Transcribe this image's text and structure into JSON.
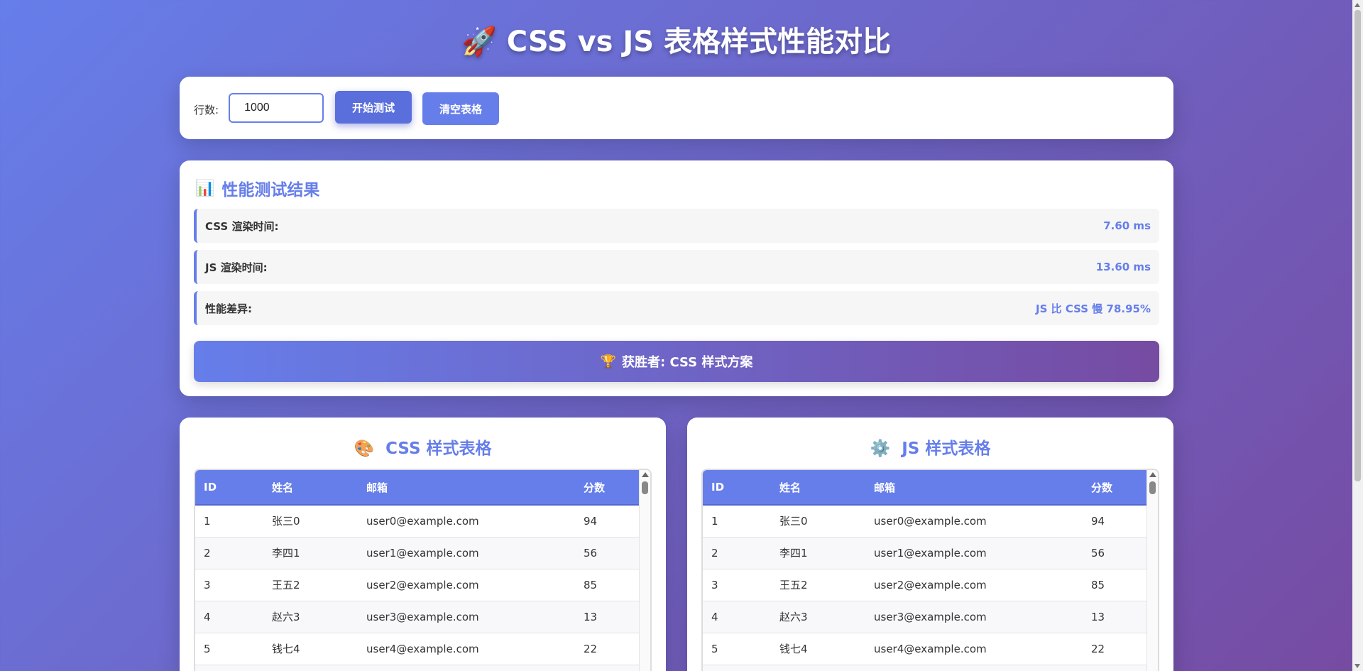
{
  "header": {
    "icon": "rocket-icon",
    "icon_glyph": "🚀",
    "title": "CSS vs JS 表格样式性能对比"
  },
  "controls": {
    "rows_label": "行数:",
    "rows_value": "1000",
    "start_label": "开始测试",
    "clear_label": "清空表格"
  },
  "results": {
    "icon": "bar-chart-icon",
    "icon_glyph": "📊",
    "title": "性能测试结果",
    "metrics": [
      {
        "label": "CSS 渲染时间:",
        "value": "7.60 ms"
      },
      {
        "label": "JS 渲染时间:",
        "value": "13.60 ms"
      },
      {
        "label": "性能差异:",
        "value": "JS 比 CSS 慢 78.95%"
      }
    ],
    "winner_icon": "trophy-icon",
    "winner_glyph": "🏆",
    "winner_text": "获胜者: CSS 样式方案"
  },
  "css_table": {
    "icon": "palette-icon",
    "icon_glyph": "🎨",
    "title": "CSS 样式表格",
    "columns": [
      "ID",
      "姓名",
      "邮箱",
      "分数"
    ],
    "rows": [
      [
        "1",
        "张三0",
        "user0@example.com",
        "94"
      ],
      [
        "2",
        "李四1",
        "user1@example.com",
        "56"
      ],
      [
        "3",
        "王五2",
        "user2@example.com",
        "85"
      ],
      [
        "4",
        "赵六3",
        "user3@example.com",
        "13"
      ],
      [
        "5",
        "钱七4",
        "user4@example.com",
        "22"
      ]
    ]
  },
  "js_table": {
    "icon": "gear-icon",
    "icon_glyph": "⚙️",
    "title": "JS 样式表格",
    "columns": [
      "ID",
      "姓名",
      "邮箱",
      "分数"
    ],
    "rows": [
      [
        "1",
        "张三0",
        "user0@example.com",
        "94"
      ],
      [
        "2",
        "李四1",
        "user1@example.com",
        "56"
      ],
      [
        "3",
        "王五2",
        "user2@example.com",
        "85"
      ],
      [
        "4",
        "赵六3",
        "user3@example.com",
        "13"
      ],
      [
        "5",
        "钱七4",
        "user4@example.com",
        "22"
      ]
    ]
  },
  "colors": {
    "accent": "#667eea",
    "gradient_end": "#764ba2"
  }
}
